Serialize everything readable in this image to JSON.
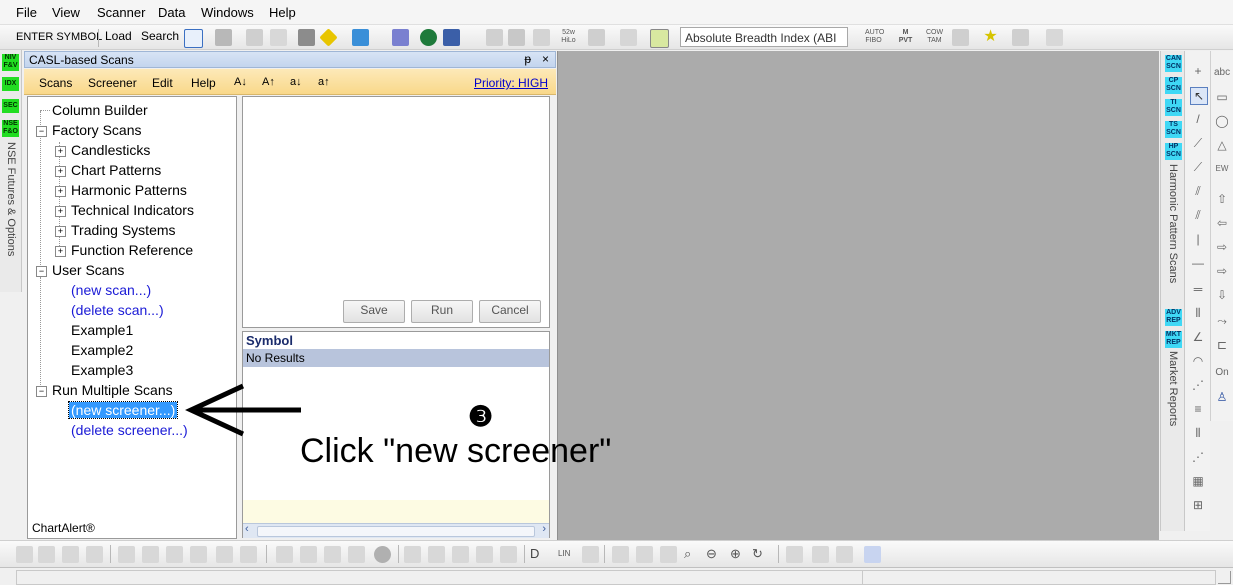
{
  "menubar": {
    "items": [
      "File",
      "View",
      "Scanner",
      "Data",
      "Windows",
      "Help"
    ]
  },
  "toolbar": {
    "enter_symbol": "ENTER SYMBOL",
    "load": "Load",
    "search": "Search",
    "breadth_select": "Absolute Breadth Index (ABI",
    "icons": [
      "hilo-52w-icon",
      "fibo-icon",
      "mpvt-icon",
      "tam-icon",
      "star-icon"
    ],
    "icon_labels": {
      "hilo": "52w HiLo",
      "fibo": "AUTO FIBO",
      "mpvt": "M PVT",
      "tam": "COW TAM"
    }
  },
  "left_strip": {
    "badges": [
      "NIV F&V",
      "IDX",
      "SEC",
      "NSE F&O"
    ],
    "vertical_label": "NSE Futures & Options"
  },
  "scans_panel": {
    "title": "CASL-based Scans",
    "menu": [
      "Scans",
      "Screener",
      "Edit",
      "Help"
    ],
    "priority": "Priority: HIGH",
    "tree": {
      "column_builder": "Column Builder",
      "factory_scans": "Factory Scans",
      "factory_children": [
        "Candlesticks",
        "Chart Patterns",
        "Harmonic Patterns",
        "Technical Indicators",
        "Trading Systems",
        "Function Reference"
      ],
      "user_scans": "User Scans",
      "user_children": [
        "(new scan...)",
        "(delete scan...)",
        "Example1",
        "Example2",
        "Example3"
      ],
      "run_multiple": "Run Multiple Scans",
      "run_children": [
        "(new screener...)",
        "(delete screener...)"
      ]
    },
    "footer": "ChartAlert®",
    "buttons": {
      "save": "Save",
      "run": "Run",
      "cancel": "Cancel"
    },
    "results": {
      "header": "Symbol",
      "row": "No Results"
    }
  },
  "annotation": {
    "step": "❸",
    "instruction": "Click \"new screener\""
  },
  "right_strip": {
    "badges": [
      "CAN SCN",
      "CP SCN",
      "TI SCN",
      "TS SCN",
      "HP SCN"
    ],
    "label1": "Harmonic Pattern Scans",
    "badges2": [
      "ADV REP",
      "MKT REP"
    ],
    "label2": "Market Reports"
  },
  "draw_tools": {
    "abc": "abc",
    "on": "On"
  },
  "bottom_toolbar": {
    "lin": "LIN"
  },
  "colors": {
    "panel_menu": "#f9d88a",
    "work_area": "#ababab",
    "selection": "#3399ff",
    "link": "#1a1ad6",
    "badge_green": "#22dd22",
    "badge_cyan": "#3fd8f5"
  }
}
